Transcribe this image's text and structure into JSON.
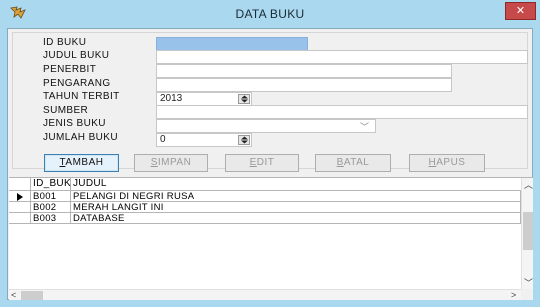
{
  "window": {
    "title": "DATA BUKU",
    "close_glyph": "✕",
    "app_icon": "app-logo-icon"
  },
  "form": {
    "fields": [
      {
        "key": "id_buku",
        "label": "ID BUKU",
        "value": ""
      },
      {
        "key": "judul_buku",
        "label": "JUDUL BUKU",
        "value": ""
      },
      {
        "key": "penerbit",
        "label": "PENERBIT",
        "value": ""
      },
      {
        "key": "pengarang",
        "label": "PENGARANG",
        "value": ""
      },
      {
        "key": "tahun_terbit",
        "label": "TAHUN TERBIT",
        "value": "2013"
      },
      {
        "key": "sumber",
        "label": "SUMBER",
        "value": ""
      },
      {
        "key": "jenis_buku",
        "label": "JENIS BUKU",
        "value": ""
      },
      {
        "key": "jumlah_buku",
        "label": "JUMLAH BUKU",
        "value": "0"
      }
    ]
  },
  "buttons": {
    "tambah": {
      "first": "T",
      "rest": "AMBAH"
    },
    "simpan": {
      "first": "S",
      "rest": "IMPAN"
    },
    "edit": {
      "first": "E",
      "rest": "DIT"
    },
    "batal": {
      "first": "B",
      "rest": "ATAL"
    },
    "hapus": {
      "first": "H",
      "rest": "APUS"
    }
  },
  "grid": {
    "columns": [
      "ID_BUKU",
      "JUDUL"
    ],
    "rows": [
      {
        "id": "B001",
        "judul": "PELANGI DI NEGRI RUSA"
      },
      {
        "id": "B002",
        "judul": "MERAH LANGIT INI"
      },
      {
        "id": "B003",
        "judul": "DATABASE"
      }
    ],
    "scroll_up": "︿",
    "scroll_down": "﹀",
    "scroll_left": "<",
    "scroll_right": ">"
  },
  "colors": {
    "title_bar": "#a9d8ef",
    "close_button": "#c74a4a",
    "selected_field": "#99c2ea",
    "focused_button_border": "#3c7fb1"
  }
}
